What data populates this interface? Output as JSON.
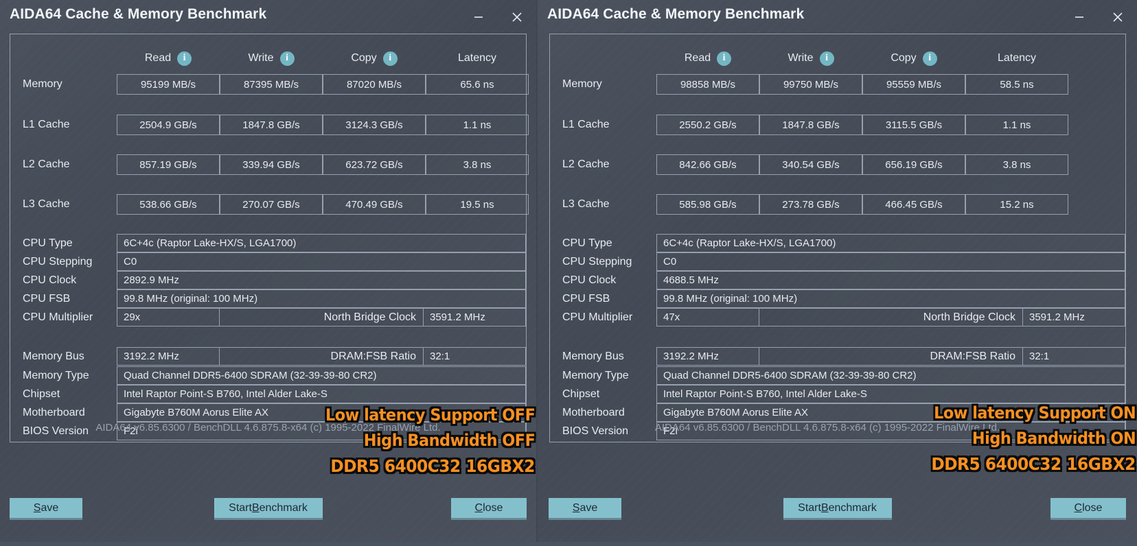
{
  "windows": [
    {
      "title": "AIDA64 Cache & Memory Benchmark",
      "titlebar": {
        "minimize_icon": "minimize-icon",
        "close_icon": "close-icon"
      },
      "benchmark": {
        "columns": [
          "Read",
          "Write",
          "Copy",
          "Latency"
        ],
        "info_icon": "info-icon",
        "rows": [
          {
            "label": "Memory",
            "read": "95199 MB/s",
            "write": "87395 MB/s",
            "copy": "87020 MB/s",
            "latency": "65.6 ns"
          },
          {
            "label": "L1 Cache",
            "read": "2504.9 GB/s",
            "write": "1847.8 GB/s",
            "copy": "3124.3 GB/s",
            "latency": "1.1 ns"
          },
          {
            "label": "L2 Cache",
            "read": "857.19 GB/s",
            "write": "339.94 GB/s",
            "copy": "623.72 GB/s",
            "latency": "3.8 ns"
          },
          {
            "label": "L3 Cache",
            "read": "538.66 GB/s",
            "write": "270.07 GB/s",
            "copy": "470.49 GB/s",
            "latency": "19.5 ns"
          }
        ]
      },
      "cpu": {
        "type_label": "CPU Type",
        "type_value": "6C+4c   (Raptor Lake-HX/S, LGA1700)",
        "stepping_label": "CPU Stepping",
        "stepping_value": "C0",
        "clock_label": "CPU Clock",
        "clock_value": "2892.9 MHz",
        "fsb_label": "CPU FSB",
        "fsb_value": "99.8 MHz  (original: 100 MHz)",
        "multiplier_label": "CPU Multiplier",
        "multiplier_value": "29x",
        "nb_label": "North Bridge Clock",
        "nb_value": "3591.2 MHz"
      },
      "memory": {
        "bus_label": "Memory Bus",
        "bus_value": "3192.2 MHz",
        "ratio_label": "DRAM:FSB Ratio",
        "ratio_value": "32:1",
        "type_label": "Memory Type",
        "type_value": "Quad Channel DDR5-6400 SDRAM  (32-39-39-80 CR2)",
        "chipset_label": "Chipset",
        "chipset_value": "Intel Raptor Point-S B760, Intel Alder Lake-S",
        "motherboard_label": "Motherboard",
        "motherboard_value": "Gigabyte B760M Aorus Elite AX",
        "bios_label": "BIOS Version",
        "bios_value": "F2i"
      },
      "footer": "AIDA64 v6.85.6300 / BenchDLL 4.6.875.8-x64  (c) 1995-2022 FinalWire Ltd.",
      "buttons": {
        "save": {
          "pre": "",
          "key": "S",
          "post": "ave"
        },
        "start": {
          "pre": "Start ",
          "key": "B",
          "post": "enchmark"
        },
        "close": {
          "pre": "",
          "key": "C",
          "post": "lose"
        }
      },
      "annotations": [
        "Low latency Support OFF",
        "High Bandwidth OFF",
        "DDR5 6400C32 16GBX2"
      ]
    },
    {
      "title": "AIDA64 Cache & Memory Benchmark",
      "titlebar": {
        "minimize_icon": "minimize-icon",
        "close_icon": "close-icon"
      },
      "benchmark": {
        "columns": [
          "Read",
          "Write",
          "Copy",
          "Latency"
        ],
        "info_icon": "info-icon",
        "rows": [
          {
            "label": "Memory",
            "read": "98858 MB/s",
            "write": "99750 MB/s",
            "copy": "95559 MB/s",
            "latency": "58.5 ns"
          },
          {
            "label": "L1 Cache",
            "read": "2550.2 GB/s",
            "write": "1847.8 GB/s",
            "copy": "3115.5 GB/s",
            "latency": "1.1 ns"
          },
          {
            "label": "L2 Cache",
            "read": "842.66 GB/s",
            "write": "340.54 GB/s",
            "copy": "656.19 GB/s",
            "latency": "3.8 ns"
          },
          {
            "label": "L3 Cache",
            "read": "585.98 GB/s",
            "write": "273.78 GB/s",
            "copy": "466.45 GB/s",
            "latency": "15.2 ns"
          }
        ]
      },
      "cpu": {
        "type_label": "CPU Type",
        "type_value": "6C+4c   (Raptor Lake-HX/S, LGA1700)",
        "stepping_label": "CPU Stepping",
        "stepping_value": "C0",
        "clock_label": "CPU Clock",
        "clock_value": "4688.5 MHz",
        "fsb_label": "CPU FSB",
        "fsb_value": "99.8 MHz  (original: 100 MHz)",
        "multiplier_label": "CPU Multiplier",
        "multiplier_value": "47x",
        "nb_label": "North Bridge Clock",
        "nb_value": "3591.2 MHz"
      },
      "memory": {
        "bus_label": "Memory Bus",
        "bus_value": "3192.2 MHz",
        "ratio_label": "DRAM:FSB Ratio",
        "ratio_value": "32:1",
        "type_label": "Memory Type",
        "type_value": "Quad Channel DDR5-6400 SDRAM  (32-39-39-80 CR2)",
        "chipset_label": "Chipset",
        "chipset_value": "Intel Raptor Point-S B760, Intel Alder Lake-S",
        "motherboard_label": "Motherboard",
        "motherboard_value": "Gigabyte B760M Aorus Elite AX",
        "bios_label": "BIOS Version",
        "bios_value": "F2i"
      },
      "footer": "AIDA64 v6.85.6300 / BenchDLL 4.6.875.8-x64  (c) 1995-2022 FinalWire Ltd.",
      "buttons": {
        "save": {
          "pre": "",
          "key": "S",
          "post": "ave"
        },
        "start": {
          "pre": "Start ",
          "key": "B",
          "post": "enchmark"
        },
        "close": {
          "pre": "",
          "key": "C",
          "post": "lose"
        }
      },
      "annotations": [
        "Low latency Support ON",
        "High Bandwidth ON",
        "DDR5 6400C32 16GBX2"
      ]
    }
  ],
  "colors": {
    "window_bg": "#454c58",
    "border": "#97a0ad",
    "text": "#e8ebef",
    "button_bg": "#84c0cc",
    "info_icon": "#74b7c4",
    "annotation": "#f79021",
    "annotation_outline": "#0c0c0c"
  }
}
